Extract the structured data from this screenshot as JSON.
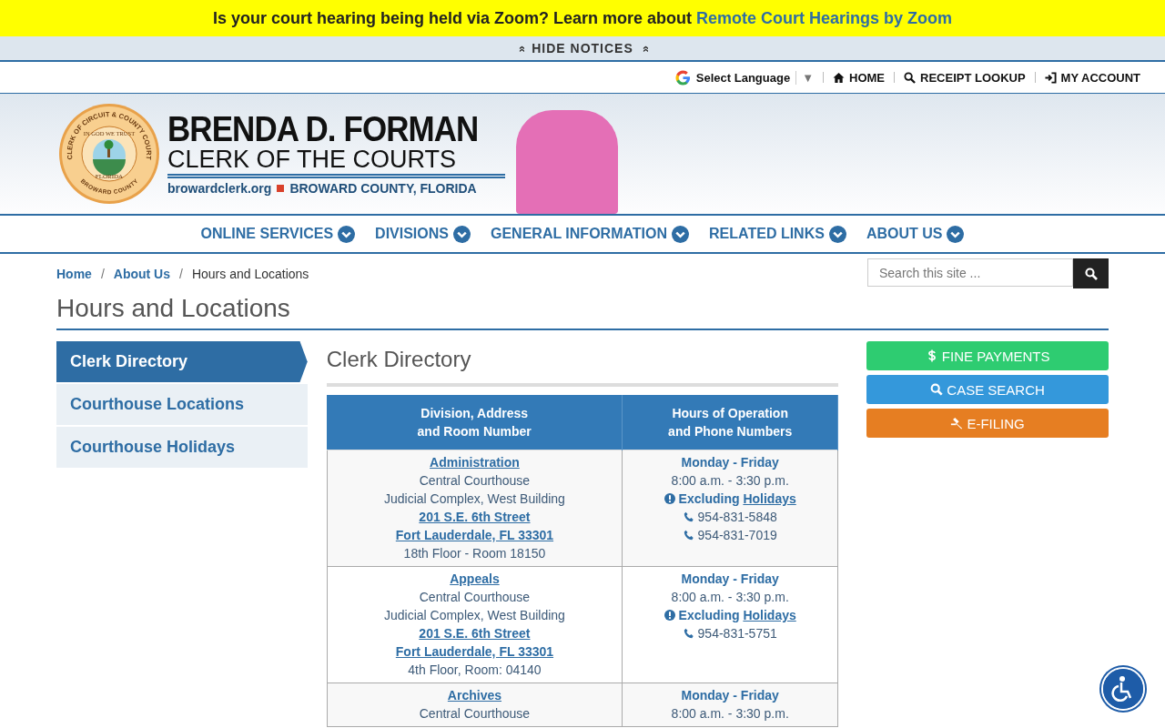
{
  "notice": {
    "text": "Is your court hearing being held via Zoom? Learn more about ",
    "link": "Remote Court Hearings by Zoom"
  },
  "hide_notices": {
    "label": "HIDE NOTICES",
    "icon": "»"
  },
  "utility_bar": {
    "language": "Select Language",
    "language_caret": "▼",
    "links": [
      {
        "kind": "home",
        "label": "HOME"
      },
      {
        "kind": "search",
        "label": "RECEIPT LOOKUP"
      },
      {
        "kind": "login",
        "label": "MY ACCOUNT"
      }
    ]
  },
  "header": {
    "seal": {
      "outer_top": "CLERK OF CIRCUIT & COUNTY COURT",
      "outer_bottom": "BROWARD COUNTY",
      "motto": "IN GOD WE TRUST",
      "state": "FLORIDA"
    },
    "name": "BRENDA D. FORMAN",
    "title": "CLERK OF THE COURTS",
    "website": "browardclerk.org",
    "location": "BROWARD COUNTY, FLORIDA"
  },
  "nav": [
    {
      "label": "ONLINE SERVICES"
    },
    {
      "label": "DIVISIONS"
    },
    {
      "label": "GENERAL INFORMATION"
    },
    {
      "label": "RELATED LINKS"
    },
    {
      "label": "ABOUT US"
    }
  ],
  "breadcrumb_separator": "/",
  "breadcrumb": [
    {
      "label": "Home",
      "link": true
    },
    {
      "label": "About Us",
      "link": true
    },
    {
      "label": "Hours and Locations",
      "link": false
    }
  ],
  "search": {
    "placeholder": "Search this site ..."
  },
  "page_title": "Hours and Locations",
  "sidebar": [
    {
      "label": "Clerk Directory",
      "selected": true
    },
    {
      "label": "Courthouse Locations",
      "selected": false
    },
    {
      "label": "Courthouse Holidays",
      "selected": false
    }
  ],
  "section_title": "Clerk Directory",
  "table": {
    "columns": [
      "Division, Address\nand Room Number",
      "Hours of Operation\nand Phone Numbers"
    ],
    "rows": [
      {
        "division": "Administration",
        "building": "Central Courthouse",
        "complex": "Judicial Complex, West Building",
        "street": "201 S.E. 6th Street",
        "city": "Fort Lauderdale, FL 33301",
        "room": "18th Floor - Room 18150",
        "days": "Monday - Friday",
        "hours": "8:00 a.m. - 3:30 p.m.",
        "excluding": "Excluding",
        "holidays": "Holidays",
        "phones": [
          "954-831-5848",
          "954-831-7019"
        ]
      },
      {
        "division": "Appeals",
        "building": "Central Courthouse",
        "complex": "Judicial Complex, West Building",
        "street": "201 S.E. 6th Street",
        "city": "Fort Lauderdale, FL 33301",
        "room": "4th Floor, Room: 04140",
        "days": "Monday - Friday",
        "hours": "8:00 a.m. - 3:30 p.m.",
        "excluding": "Excluding",
        "holidays": "Holidays",
        "phones": [
          "954-831-5751"
        ]
      },
      {
        "division": "Archives",
        "building": "Central Courthouse",
        "days": "Monday - Friday",
        "hours": "8:00 a.m. - 3:30 p.m.",
        "phones": []
      }
    ]
  },
  "quick_links": [
    {
      "kind": "payment",
      "label": "FINE PAYMENTS",
      "color": "#2ecc71"
    },
    {
      "kind": "search",
      "label": "CASE SEARCH",
      "color": "#3498db"
    },
    {
      "kind": "gavel",
      "label": "E-FILING",
      "color": "#e67e22"
    }
  ]
}
